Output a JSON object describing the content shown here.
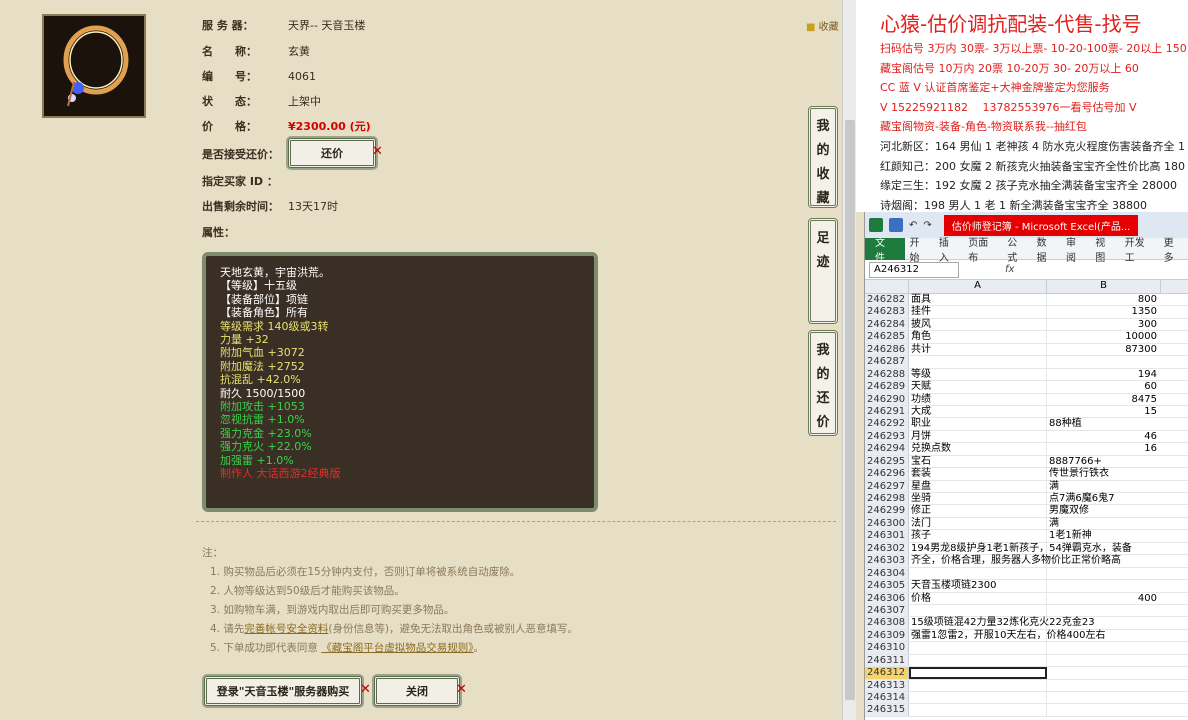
{
  "trade": {
    "favorite": "收藏",
    "server_label": "服 务 器：",
    "server_value": "天界-- 天音玉楼",
    "name_label": "名　　称：",
    "name_value": "玄黄",
    "id_label": "编　　号：",
    "id_value": "4061",
    "status_label": "状　　态：",
    "status_value": "上架中",
    "price_label": "价　　格：",
    "price_value": "¥2300.00 (元)",
    "bargain_label": "是否接受还价：",
    "bargain_button": "还价",
    "buyer_label": "指定买家 ID ：",
    "remaining_label": "出售剩余时间：",
    "remaining_value": "13天17时",
    "attr_label": "属性：",
    "attributes": [
      {
        "text": "天地玄黄，宇宙洪荒。",
        "color": "#ffffff"
      },
      {
        "text": "【等级】十五级",
        "color": "#ffffff"
      },
      {
        "text": "【装备部位】项链",
        "color": "#ffffff"
      },
      {
        "text": "【装备角色】所有",
        "color": "#ffffff"
      },
      {
        "text": "等级需求 140级或3转",
        "color": "#e8e070"
      },
      {
        "text": "力量 +32",
        "color": "#e8e070"
      },
      {
        "text": "附加气血 +3072",
        "color": "#e8e070"
      },
      {
        "text": "附加魔法 +2752",
        "color": "#e8e070"
      },
      {
        "text": "抗混乱 +42.0%",
        "color": "#e8e070"
      },
      {
        "text": "耐久 1500/1500",
        "color": "#ffffff"
      },
      {
        "text": "附加攻击 +1053",
        "color": "#37d44a"
      },
      {
        "text": "忽视抗雷 +1.0%",
        "color": "#37d44a"
      },
      {
        "text": "强力克金 +23.0%",
        "color": "#37d44a"
      },
      {
        "text": "强力克火 +22.0%",
        "color": "#37d44a"
      },
      {
        "text": "加强雷 +1.0%",
        "color": "#37d44a"
      },
      {
        "text": "制作人 大话西游2经典版",
        "color": "#e0302a"
      }
    ],
    "notes_title": "注：",
    "notes": [
      {
        "pre": "1. 购买物品后必须在15分钟内支付，否则订单将被系统自动废除。",
        "link": "",
        "post": ""
      },
      {
        "pre": "2. 人物等级达到50级后才能购买该物品。",
        "link": "",
        "post": ""
      },
      {
        "pre": "3. 如购物车满，到游戏内取出后即可购买更多物品。",
        "link": "",
        "post": ""
      },
      {
        "pre": "4. 请先",
        "link": "完善帐号安全资料",
        "post": "(身份信息等)，避免无法取出角色或被别人恶意填写。"
      },
      {
        "pre": "5. 下单成功即代表同意 ",
        "link": "《藏宝阁平台虚拟物品交易规则》",
        "post": "。"
      }
    ],
    "buy_button": "登录\"天音玉楼\"服务器购买",
    "close_button": "关闭",
    "side_tabs": [
      "我的收藏",
      "足迹",
      "我的还价"
    ]
  },
  "ad": {
    "headline": "心猿-估价调抗配装-代售-找号",
    "lines": [
      {
        "text": "扫码估号 3万内 30票- 3万以上票- 10-20-100票- 20以上 150",
        "color": "#e0201c"
      },
      {
        "text": "藏宝阁估号 10万内 20票 10-20万 30- 20万以上 60",
        "color": "#e0201c"
      },
      {
        "text": "CC 蓝 V 认证首席鉴定+大神金牌鉴定为您服务",
        "color": "#e0201c"
      },
      {
        "text": "V 15225921182　 13782553976一看号估号加 V",
        "color": "#e0201c"
      },
      {
        "text": "藏宝阁物资-装备-角色-物资联系我--抽红包",
        "color": "#e0201c"
      },
      {
        "text": "河北新区：164 男仙 1 老神孩 4 防水克火程度伤害装备齐全 1",
        "color": "#222222"
      },
      {
        "text": "红颜知己：200 女魔 2 新孩克火抽装备宝宝齐全性价比高 180",
        "color": "#222222"
      },
      {
        "text": "缘定三生：192 女魔 2 孩子克水抽全满装备宝宝齐全 28000",
        "color": "#222222"
      },
      {
        "text": "诗烟阁：198 男人 1 老 1 新全满装备宝宝齐全 38800",
        "color": "#222222"
      }
    ]
  },
  "excel": {
    "title": "估价师登记簿 - Microsoft Excel(产品...",
    "ribbon_file": "文件",
    "ribbon_tabs": [
      "开始",
      "插入",
      "页面布",
      "公式",
      "数据",
      "审阅",
      "视图",
      "开发工",
      "更多"
    ],
    "name_box": "A246312",
    "fx": "fx",
    "col_a": "A",
    "col_b": "B",
    "rows": [
      {
        "n": "246282",
        "a": "面具",
        "b": "800",
        "num": true
      },
      {
        "n": "246283",
        "a": "挂件",
        "b": "1350",
        "num": true
      },
      {
        "n": "246284",
        "a": "披风",
        "b": "300",
        "num": true
      },
      {
        "n": "246285",
        "a": "角色",
        "b": "10000",
        "num": true
      },
      {
        "n": "246286",
        "a": "共计",
        "b": "87300",
        "num": true
      },
      {
        "n": "246287",
        "a": "",
        "b": "",
        "num": true
      },
      {
        "n": "246288",
        "a": "等级",
        "b": "194",
        "num": true
      },
      {
        "n": "246289",
        "a": "天赋",
        "b": "60",
        "num": true
      },
      {
        "n": "246290",
        "a": "功绩",
        "b": "8475",
        "num": true
      },
      {
        "n": "246291",
        "a": "大成",
        "b": "15",
        "num": true
      },
      {
        "n": "246292",
        "a": "职业",
        "b": "88种植",
        "num": false
      },
      {
        "n": "246293",
        "a": "月饼",
        "b": "46",
        "num": true
      },
      {
        "n": "246294",
        "a": "兑换点数",
        "b": "16",
        "num": true
      },
      {
        "n": "246295",
        "a": "宝石",
        "b": "8887766+",
        "num": false
      },
      {
        "n": "246296",
        "a": "套装",
        "b": "传世景行铁衣",
        "num": false
      },
      {
        "n": "246297",
        "a": "星盘",
        "b": "满",
        "num": false
      },
      {
        "n": "246298",
        "a": "坐骑",
        "b": "点7满6魔6鬼7",
        "num": false
      },
      {
        "n": "246299",
        "a": "修正",
        "b": "男魔双修",
        "num": false
      },
      {
        "n": "246300",
        "a": "法门",
        "b": "满",
        "num": false
      },
      {
        "n": "246301",
        "a": "孩子",
        "b": "1老1新神",
        "num": false
      },
      {
        "n": "246302",
        "a": "194男龙8级护身1老1新孩子，54弹霸克水，装备",
        "b": "",
        "num": false
      },
      {
        "n": "246303",
        "a": "齐全，价格合理，服务器人多物价比正常价略高",
        "b": "",
        "num": false
      },
      {
        "n": "246304",
        "a": "",
        "b": "",
        "num": false
      },
      {
        "n": "246305",
        "a": "天音玉楼项链2300",
        "b": "",
        "num": false
      },
      {
        "n": "246306",
        "a": "价格",
        "b": "400",
        "num": true
      },
      {
        "n": "246307",
        "a": "",
        "b": "",
        "num": false
      },
      {
        "n": "246308",
        "a": "15级项链混42力量32炼化克火22克金23",
        "b": "",
        "num": false
      },
      {
        "n": "246309",
        "a": "强雷1忽雷2，开服10天左右，价格400左右",
        "b": "",
        "num": false
      },
      {
        "n": "246310",
        "a": "",
        "b": "",
        "num": false
      },
      {
        "n": "246311",
        "a": "",
        "b": "",
        "num": false
      },
      {
        "n": "246312",
        "a": "",
        "b": "",
        "num": false
      },
      {
        "n": "246313",
        "a": "",
        "b": "",
        "num": false
      },
      {
        "n": "246314",
        "a": "",
        "b": "",
        "num": false
      },
      {
        "n": "246315",
        "a": "",
        "b": "",
        "num": false
      }
    ],
    "selected_row": "246312"
  }
}
